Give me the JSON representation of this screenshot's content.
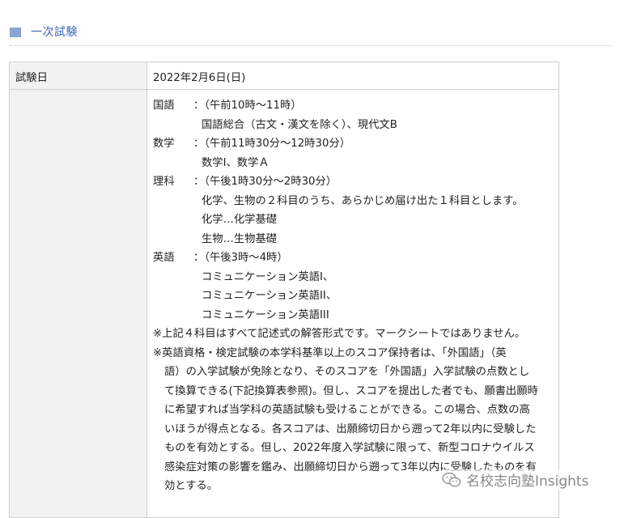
{
  "section": {
    "title": "一次試験"
  },
  "table": {
    "date_label": "試験日",
    "date_value": "2022年2月6日(日)",
    "subjects": [
      {
        "name": "国語",
        "time": "：（午前10時～11時）",
        "details": [
          "国語総合（古文・漢文を除く）、現代文B"
        ]
      },
      {
        "name": "数学",
        "time": "：（午前11時30分～12時30分）",
        "details": [
          "数学I、数学Ａ"
        ]
      },
      {
        "name": "理科",
        "time": "：（午後1時30分～2時30分）",
        "details": [
          "化学、生物の２科目のうち、あらかじめ届け出た１科目とします。",
          "化学…化学基礎",
          "生物…生物基礎"
        ]
      },
      {
        "name": "英語",
        "time": "：（午後3時～4時）",
        "details": [
          "コミュニケーション英語I、",
          "コミュニケーション英語II、",
          "コミュニケーション英語III"
        ]
      }
    ],
    "note1": "※上記４科目はすべて記述式の解答形式です。マークシートではありません。",
    "note2": [
      "※英語資格・検定試験の本学科基準以上のスコア保持者は、「外国語」（英",
      "語）の入学試験が免除となり、そのスコアを「外国語」入学試験の点数とし",
      "て換算できる(下記換算表参照)。但し、スコアを提出した者でも、願書出願時",
      "に希望すれば当学科の英語試験も受けることができる。この場合、点数の高",
      "いほうが得点となる。各スコアは、出願締切日から遡って2年以内に受験した",
      "ものを有効とする。但し、2022年度入学試験に限って、新型コロナウイルス",
      "感染症対策の影響を鑑み、出願締切日から遡って3年以内に受験したものを有",
      "効とする。"
    ]
  },
  "watermark": {
    "text": "名校志向塾Insights",
    "icon": "wechat-icon"
  }
}
